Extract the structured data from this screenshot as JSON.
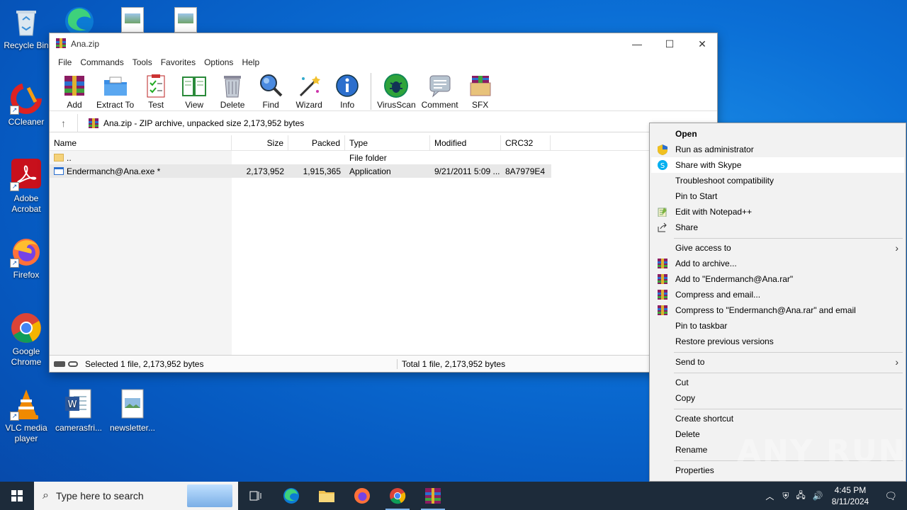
{
  "desktop": {
    "icons": [
      {
        "label": "Recycle Bin"
      },
      {
        "label": "CCleaner"
      },
      {
        "label": "Adobe Acrobat"
      },
      {
        "label": "Firefox"
      },
      {
        "label": "Google Chrome"
      },
      {
        "label": "VLC media player"
      },
      {
        "label": "camerasfri..."
      },
      {
        "label": "newsletter..."
      }
    ]
  },
  "window": {
    "title": "Ana.zip",
    "menu": [
      "File",
      "Commands",
      "Tools",
      "Favorites",
      "Options",
      "Help"
    ],
    "toolbar": [
      "Add",
      "Extract To",
      "Test",
      "View",
      "Delete",
      "Find",
      "Wizard",
      "Info",
      "VirusScan",
      "Comment",
      "SFX"
    ],
    "address": "Ana.zip - ZIP archive, unpacked size 2,173,952 bytes",
    "columns": [
      "Name",
      "Size",
      "Packed",
      "Type",
      "Modified",
      "CRC32"
    ],
    "rows": [
      {
        "name": "..",
        "size": "",
        "packed": "",
        "type": "File folder",
        "modified": "",
        "crc": ""
      },
      {
        "name": "Endermanch@Ana.exe *",
        "size": "2,173,952",
        "packed": "1,915,365",
        "type": "Application",
        "modified": "9/21/2011 5:09 ...",
        "crc": "8A7979E4"
      }
    ],
    "status_left": "Selected 1 file, 2,173,952 bytes",
    "status_right": "Total 1 file, 2,173,952 bytes"
  },
  "context_menu": {
    "items": [
      "Open",
      "Run as administrator",
      "Share with Skype",
      "Troubleshoot compatibility",
      "Pin to Start",
      "Edit with Notepad++",
      "Share",
      "Give access to",
      "Add to archive...",
      "Add to \"Endermanch@Ana.rar\"",
      "Compress and email...",
      "Compress to \"Endermanch@Ana.rar\" and email",
      "Pin to taskbar",
      "Restore previous versions",
      "Send to",
      "Cut",
      "Copy",
      "Create shortcut",
      "Delete",
      "Rename",
      "Properties"
    ]
  },
  "taskbar": {
    "search_placeholder": "Type here to search",
    "time": "4:45 PM",
    "date": "8/11/2024"
  },
  "watermark": "ANY RUN"
}
